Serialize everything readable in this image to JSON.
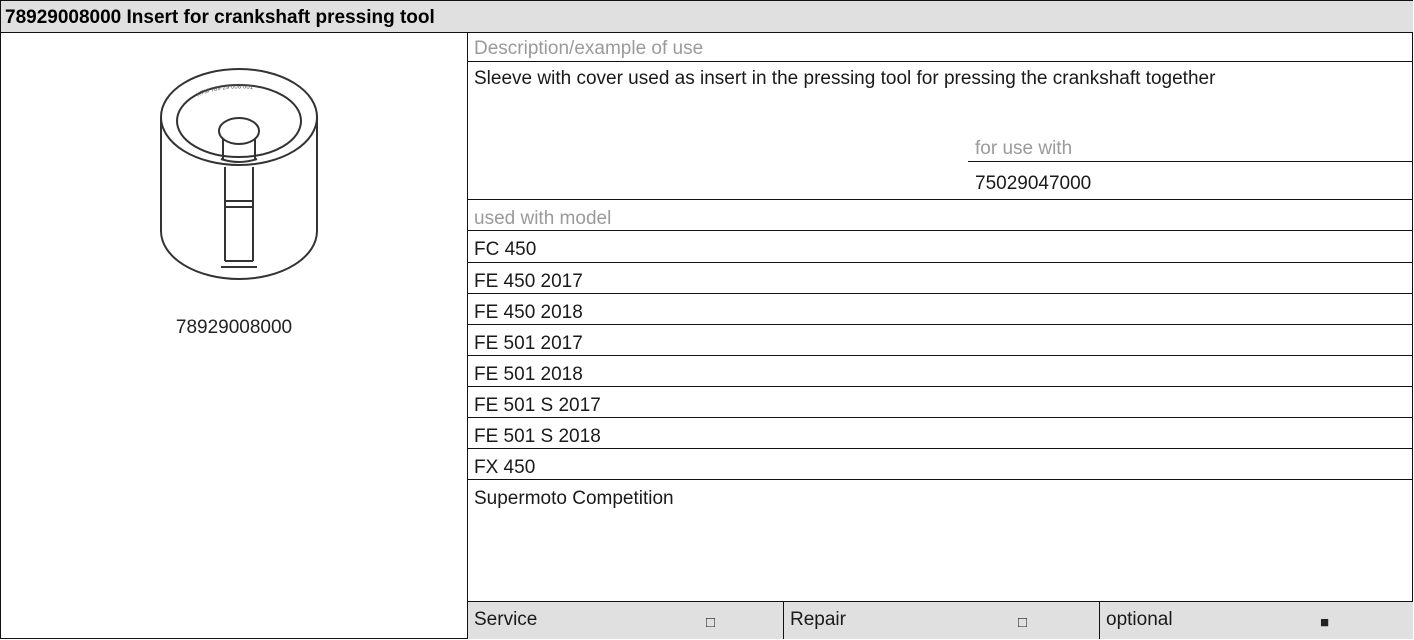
{
  "title": "78929008000 Insert for crankshaft pressing tool",
  "image": {
    "caption": "78929008000",
    "icon": "sleeve-insert-icon",
    "engraving": "KTM 789 29 008 001"
  },
  "description": {
    "heading": "Description/example of use",
    "text": "Sleeve with cover used as insert in the pressing tool for pressing the crankshaft together"
  },
  "for_use_with": {
    "label": "for use with",
    "value": "75029047000"
  },
  "used_with_model": {
    "label": "used with model",
    "models": [
      "FC 450",
      "FE 450 2017",
      "FE 450 2018",
      "FE 501 2017",
      "FE 501 2018",
      "FE 501 S 2017",
      "FE 501 S 2018",
      "FX 450",
      "Supermoto Competition"
    ]
  },
  "footer": {
    "service": {
      "label": "Service",
      "mark": "□"
    },
    "repair": {
      "label": "Repair",
      "mark": "□"
    },
    "optional": {
      "label": "optional",
      "mark": "■"
    }
  }
}
